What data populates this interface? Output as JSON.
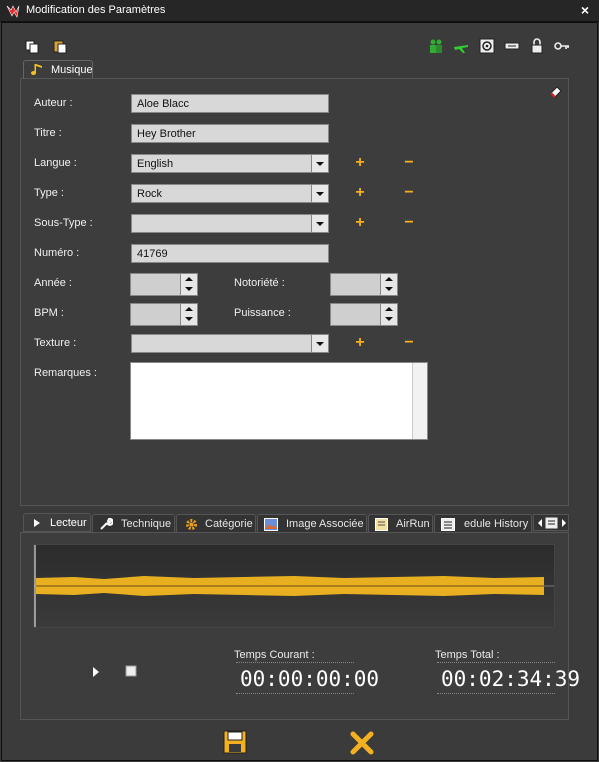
{
  "window": {
    "title": "Modification des Paramètres",
    "close_label": "×"
  },
  "toolbar": {
    "left_icons": [
      "copy-icon",
      "paste-icon"
    ],
    "right_icons": [
      "people-icon",
      "plane-icon",
      "speaker-icon",
      "tag-icon",
      "lock-icon",
      "key-icon"
    ]
  },
  "tabs_top": [
    {
      "label": "Musique",
      "icon": "music-note-icon",
      "active": true
    }
  ],
  "form": {
    "auteur": {
      "label": "Auteur :",
      "value": "Aloe Blacc"
    },
    "titre": {
      "label": "Titre :",
      "value": "Hey Brother"
    },
    "langue": {
      "label": "Langue :",
      "value": "English"
    },
    "type": {
      "label": "Type :",
      "value": "Rock"
    },
    "sous_type": {
      "label": "Sous-Type :",
      "value": ""
    },
    "numero": {
      "label": "Numéro :",
      "value": "41769"
    },
    "annee": {
      "label": "Année :",
      "value": ""
    },
    "notoriete": {
      "label": "Notoriété :",
      "value": ""
    },
    "bpm": {
      "label": "BPM :",
      "value": ""
    },
    "puissance": {
      "label": "Puissance :",
      "value": ""
    },
    "texture": {
      "label": "Texture :",
      "value": ""
    },
    "remarques": {
      "label": "Remarques :",
      "value": ""
    },
    "plus": "+",
    "minus": "−"
  },
  "bottom_tabs": [
    {
      "label": "Lecteur",
      "icon": "play-icon",
      "active": true
    },
    {
      "label": "Technique",
      "icon": "wrench-icon",
      "active": false
    },
    {
      "label": "Catégorie",
      "icon": "gear-icon",
      "active": false
    },
    {
      "label": "Image Associée",
      "icon": "image-icon",
      "active": false
    },
    {
      "label": "AirRun",
      "icon": "document-icon",
      "active": false
    },
    {
      "label": "edule History",
      "icon": "list-icon",
      "active": false
    }
  ],
  "player": {
    "temps_courant_label": "Temps Courant :",
    "temps_courant": "00:00:00:00",
    "temps_total_label": "Temps Total :",
    "temps_total": "00:02:34:39"
  },
  "colors": {
    "accent": "#f5b020",
    "background": "#3a3a3a",
    "waveform": "#e8b020"
  }
}
